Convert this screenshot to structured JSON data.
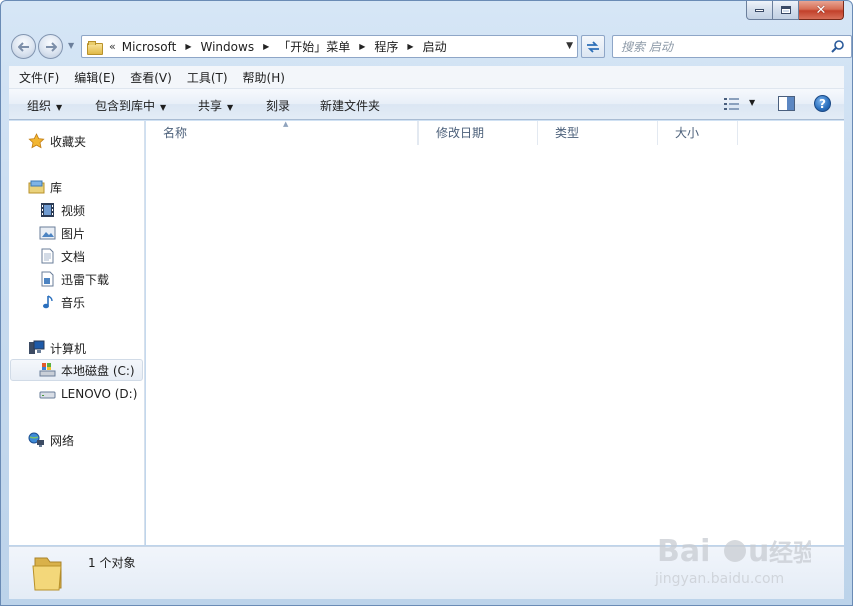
{
  "window": {
    "title_controls": {
      "minimize_icon": "minimize-icon",
      "maximize_icon": "maximize-icon",
      "close_icon": "close-icon",
      "close_glyph": "✕"
    }
  },
  "address_bar": {
    "overflow": "«",
    "crumbs": [
      "Microsoft",
      "Windows",
      "「开始」菜单",
      "程序",
      "启动"
    ]
  },
  "search": {
    "placeholder": "搜索 启动"
  },
  "menu": [
    "文件(F)",
    "编辑(E)",
    "查看(V)",
    "工具(T)",
    "帮助(H)"
  ],
  "toolbar": {
    "organize": "组织",
    "include_in_library": "包含到库中",
    "share": "共享",
    "burn": "刻录",
    "new_folder": "新建文件夹",
    "help_glyph": "?"
  },
  "nav_pane": {
    "favorites": "收藏夹",
    "libraries": "库",
    "library_items": [
      "视频",
      "图片",
      "文档",
      "迅雷下载",
      "音乐"
    ],
    "computer": "计算机",
    "drives": [
      "本地磁盘 (C:)",
      "LENOVO (D:)"
    ],
    "network": "网络"
  },
  "columns": [
    "名称",
    "修改日期",
    "类型",
    "大小"
  ],
  "details": {
    "count_text": "1 个对象"
  },
  "watermark": {
    "brand": "Baidu",
    "brand_cn": "经验",
    "url": "jingyan.baidu.com"
  },
  "colors": {
    "accent": "#2a6fbd",
    "window_frame": "#c9dcf0",
    "column_text": "#4c607a"
  }
}
